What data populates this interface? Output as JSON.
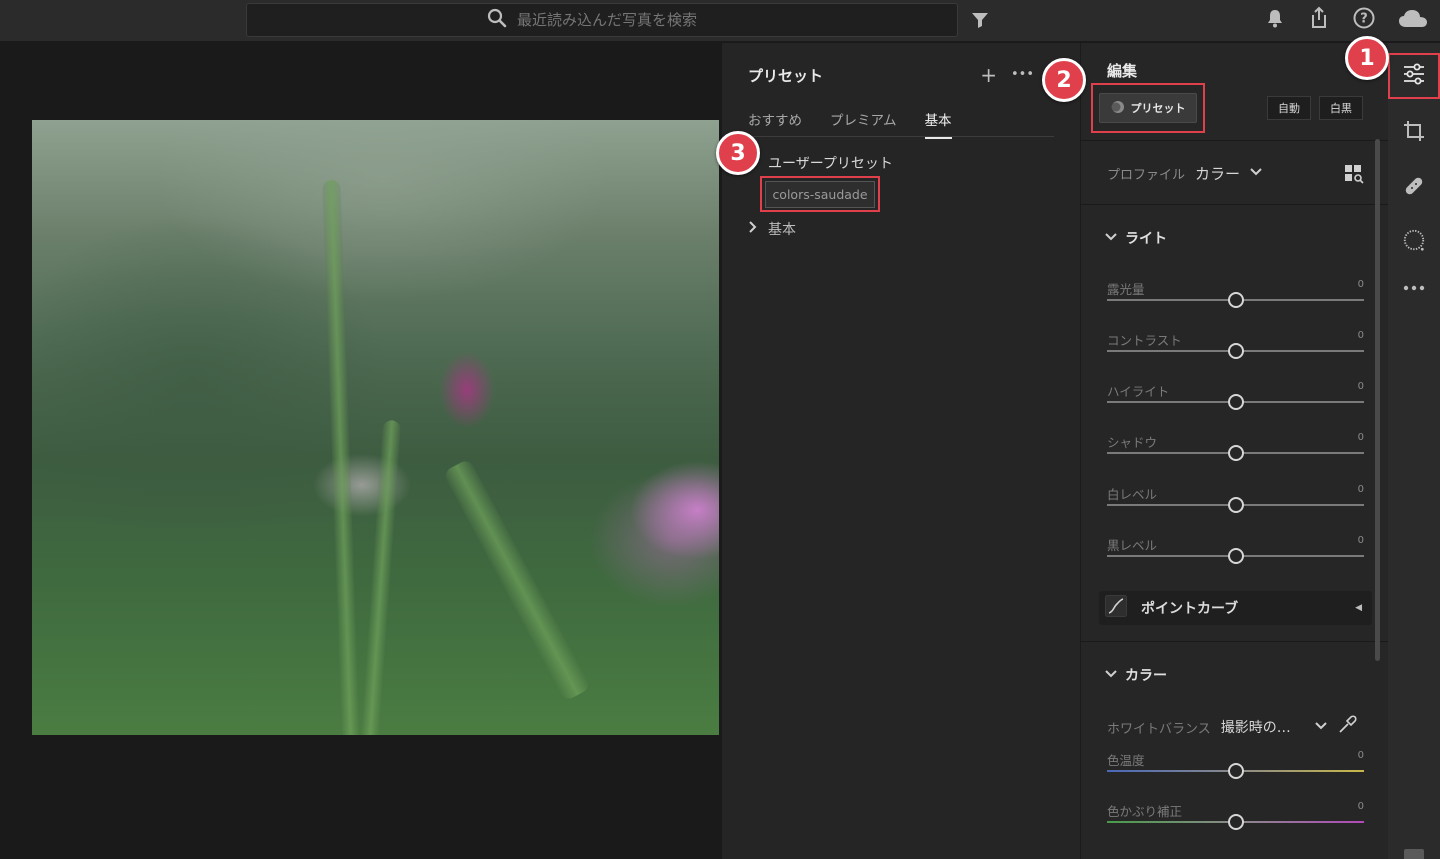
{
  "topbar": {
    "search_placeholder": "最近読み込んだ写真を検索"
  },
  "presets_panel": {
    "title": "プリセット",
    "add": "+",
    "more": "•••",
    "tabs": [
      "おすすめ",
      "プレミアム",
      "基本"
    ],
    "active_tab": "基本",
    "user_group": "ユーザープリセット",
    "user_preset_item": "colors-saudade",
    "basic_group": "基本"
  },
  "edit_panel": {
    "title": "編集",
    "preset_button": "プリセット",
    "auto_button": "自動",
    "bw_button": "白黒",
    "profile_label": "プロファイル",
    "profile_value": "カラー",
    "light_section": "ライト",
    "light_sliders": [
      {
        "label": "露光量",
        "value": "0"
      },
      {
        "label": "コントラスト",
        "value": "0"
      },
      {
        "label": "ハイライト",
        "value": "0"
      },
      {
        "label": "シャドウ",
        "value": "0"
      },
      {
        "label": "白レベル",
        "value": "0"
      },
      {
        "label": "黒レベル",
        "value": "0"
      }
    ],
    "point_curve": "ポイントカーブ",
    "color_section": "カラー",
    "white_balance_label": "ホワイトバランス",
    "white_balance_value": "撮影時の…",
    "color_sliders": [
      {
        "label": "色温度",
        "value": "0"
      },
      {
        "label": "色かぶり補正",
        "value": "0"
      }
    ]
  },
  "callouts": [
    "1",
    "2",
    "3"
  ],
  "colors": {
    "accent_red": "#e0404c",
    "panel_bg": "#262626",
    "topbar_bg": "#2b2b2b"
  }
}
